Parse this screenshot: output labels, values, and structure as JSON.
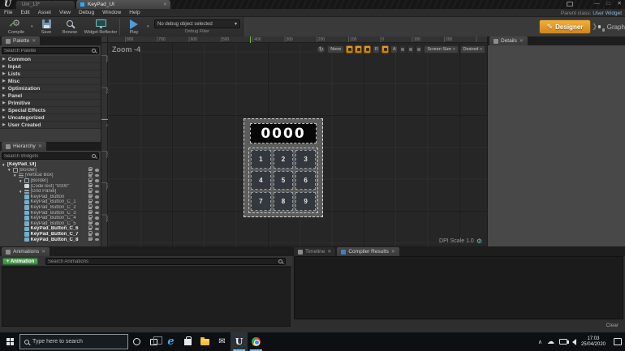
{
  "colors": {
    "accent_orange": "#e09a2b",
    "button_green": "#4a9a4f",
    "tab_icon_blue": "#4aa3dc",
    "play_blue": "#4f9dd6",
    "ruler_marker_green": "#74b33c"
  },
  "titlebar": {
    "tabs": [
      {
        "label": "Unr_13*"
      },
      {
        "label": "KeyPad_UI"
      }
    ],
    "window_buttons": [
      "minimize",
      "maximize",
      "close"
    ]
  },
  "menubar": {
    "items": [
      "File",
      "Edit",
      "Asset",
      "View",
      "Debug",
      "Window",
      "Help"
    ],
    "parent_class_label": "Parent class:",
    "parent_class_value": "User Widget"
  },
  "toolbar": {
    "compile_label": "Compile",
    "save_label": "Save",
    "browse_label": "Browse",
    "reflector_label": "Widget Reflector",
    "play_label": "Play",
    "debug_select_value": "No debug object selected",
    "debug_filter_label": "Debug Filter",
    "designer_label": "Designer",
    "graph_label": "Graph"
  },
  "palette": {
    "title": "Palette",
    "search_placeholder": "Search Palette",
    "categories": [
      "Common",
      "Input",
      "Lists",
      "Misc",
      "Optimization",
      "Panel",
      "Primitive",
      "Special Effects",
      "Uncategorized",
      "User Created"
    ]
  },
  "hierarchy": {
    "title": "Hierarchy",
    "search_placeholder": "Search Widgets",
    "tree": [
      {
        "label": "[KeyPad_UI]",
        "indent": 0,
        "type": "root",
        "bold": true,
        "expander": true,
        "icons": false
      },
      {
        "label": "[Border]",
        "indent": 1,
        "type": "border",
        "expander": true,
        "icons": true
      },
      {
        "label": "[Vertical Box]",
        "indent": 2,
        "type": "vbox",
        "expander": true,
        "icons": true
      },
      {
        "label": "[Border]",
        "indent": 3,
        "type": "border",
        "expander": true,
        "icons": true
      },
      {
        "label": "[CodeText] \"0000\"",
        "indent": 4,
        "type": "text",
        "icons": true
      },
      {
        "label": "[Grid Panel]",
        "indent": 3,
        "type": "grid",
        "expander": true,
        "icons": true
      },
      {
        "label": "KeyPad_Button",
        "indent": 4,
        "type": "button",
        "icons": true
      },
      {
        "label": "KeyPad_Button_C_1",
        "indent": 4,
        "type": "button",
        "icons": true
      },
      {
        "label": "KeyPad_Button_C_2",
        "indent": 4,
        "type": "button",
        "icons": true
      },
      {
        "label": "KeyPad_Button_C_3",
        "indent": 4,
        "type": "button",
        "icons": true
      },
      {
        "label": "KeyPad_Button_C_4",
        "indent": 4,
        "type": "button",
        "icons": true
      },
      {
        "label": "KeyPad_Button_C_5",
        "indent": 4,
        "type": "button",
        "icons": true
      },
      {
        "label": "KeyPad_Button_C_6",
        "indent": 4,
        "type": "button",
        "bold": true,
        "icons": true
      },
      {
        "label": "KeyPad_Button_C_7",
        "indent": 4,
        "type": "button",
        "bold": true,
        "icons": true
      },
      {
        "label": "KeyPad_Button_C_8",
        "indent": 4,
        "type": "button",
        "bold": true,
        "icons": true
      }
    ]
  },
  "canvas": {
    "zoom_label": "Zoom -4",
    "dpi_label": "DPI Scale 1.0",
    "toolbar": {
      "none_label": "None",
      "r_label": "R",
      "a_label": "A",
      "screen_size_label": "Screen Size",
      "desired_label": "Desired"
    },
    "ruler_top": [
      "800",
      "700",
      "600",
      "500",
      "400",
      "300",
      "200",
      "100",
      "0",
      "100",
      "200"
    ],
    "ruler_left": [
      "200",
      "100",
      "0",
      "100",
      "200",
      "300",
      "400"
    ],
    "keypad": {
      "display": "0000",
      "buttons": [
        "1",
        "2",
        "3",
        "4",
        "5",
        "6",
        "7",
        "8",
        "9"
      ]
    }
  },
  "details": {
    "title": "Details"
  },
  "animations": {
    "title": "Animations",
    "add_button_label": "+ Animation",
    "search_placeholder": "Search Animations"
  },
  "output": {
    "timeline_tab": "Timeline",
    "compiler_tab": "Compiler Results",
    "clear_label": "Clear"
  },
  "taskbar": {
    "search_placeholder": "Type here to search",
    "time": "17:03",
    "date": "25/04/2020"
  }
}
